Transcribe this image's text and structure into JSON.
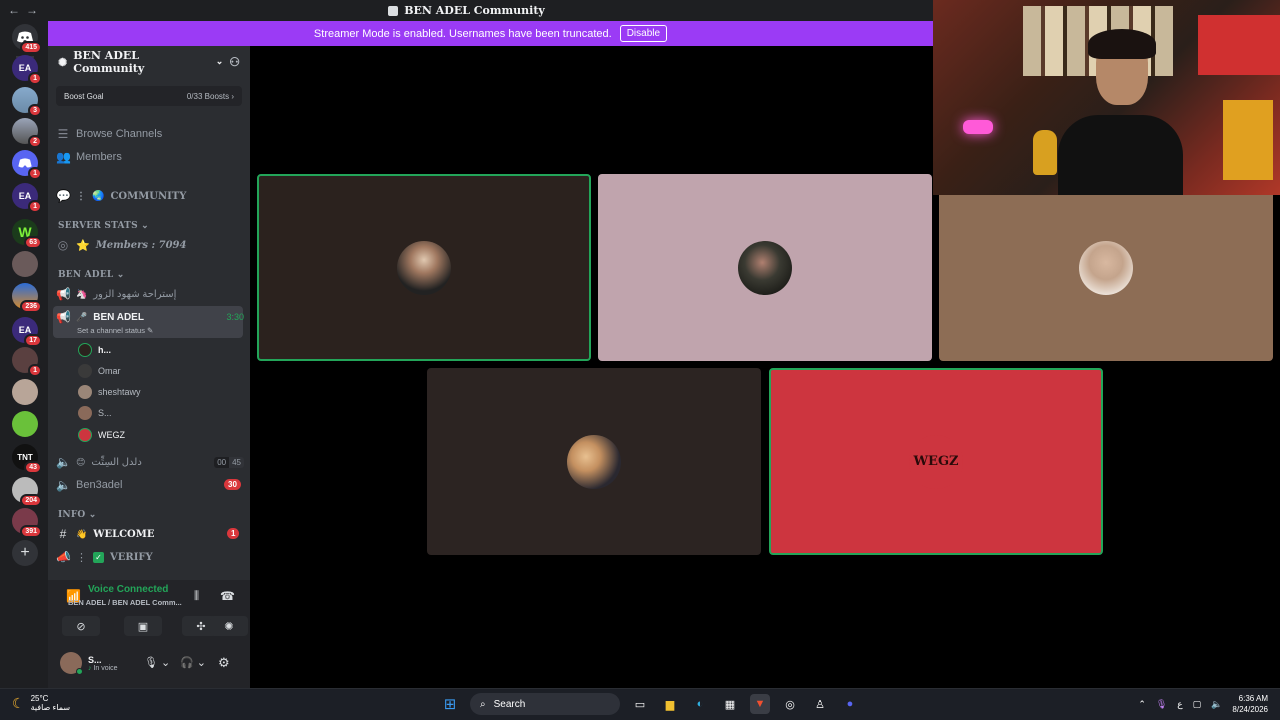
{
  "titlebar": {
    "nav_back": "←",
    "nav_fwd": "→",
    "title": "BEN ADEL Community"
  },
  "streamer": {
    "message": "Streamer Mode is enabled. Usernames have been truncated.",
    "disable_label": "Disable"
  },
  "guilds": [
    {
      "label": "",
      "badge": "415"
    },
    {
      "label": "EA",
      "badge": "1"
    },
    {
      "label": "",
      "badge": "3"
    },
    {
      "label": "",
      "badge": "2"
    },
    {
      "label": "",
      "badge": "1"
    },
    {
      "label": "EA",
      "badge": "1"
    },
    {
      "label": "W",
      "badge": "63"
    },
    {
      "label": "",
      "badge": ""
    },
    {
      "label": "",
      "badge": "236"
    },
    {
      "label": "EA",
      "badge": "17"
    },
    {
      "label": "",
      "badge": "1"
    },
    {
      "label": "",
      "badge": ""
    },
    {
      "label": "",
      "badge": ""
    },
    {
      "label": "TNT",
      "badge": "43"
    },
    {
      "label": "",
      "badge": "204"
    },
    {
      "label": "",
      "badge": "391"
    }
  ],
  "add_server": "+",
  "sidebar": {
    "server_name": "BEN ADEL Community",
    "boost_goal": "Boost Goal",
    "boost_count": "0/33 Boosts",
    "browse": "Browse Channels",
    "members": "Members",
    "community_channel": "COMMUNITY",
    "cat_server_stats": "SERVER STATS",
    "members_stat": "Members : 7094",
    "cat_ben_adel": "BEN ADEL",
    "channel_rest": "إستراحة شهود الزور",
    "vc_name": "BEN ADEL",
    "vc_time": "3:30",
    "vc_status": "Set a channel status",
    "voice_members": [
      "h...",
      "Omar",
      "sheshtawy",
      "S...",
      "WEGZ"
    ],
    "channel_balcony": "دلدل السِتِّت",
    "balcony_left": "00",
    "balcony_right": "45",
    "channel_ben3adel": "Ben3adel",
    "ben3adel_count": "30",
    "cat_info": "INFO",
    "welcome": "WELCOME",
    "welcome_count": "1",
    "verify": "VERIFY"
  },
  "voice_panel": {
    "status": "Voice Connected",
    "channel": "BEN ADEL / BEN ADEL Comm...",
    "user_name": "S...",
    "user_status": "In voice"
  },
  "taskbar": {
    "temp": "25°C",
    "weather": "سماء صافية",
    "search": "Search",
    "lang": "ع",
    "time": "6:36 AM",
    "date": "8/24/2026"
  },
  "colors": {
    "accent": "#9b3bf5",
    "speaking": "#23a559",
    "tile_dark": "#2b221e",
    "tile_pink": "#c0a4ad",
    "tile_tan": "#8d6d55",
    "tile_red": "#cd353f"
  }
}
